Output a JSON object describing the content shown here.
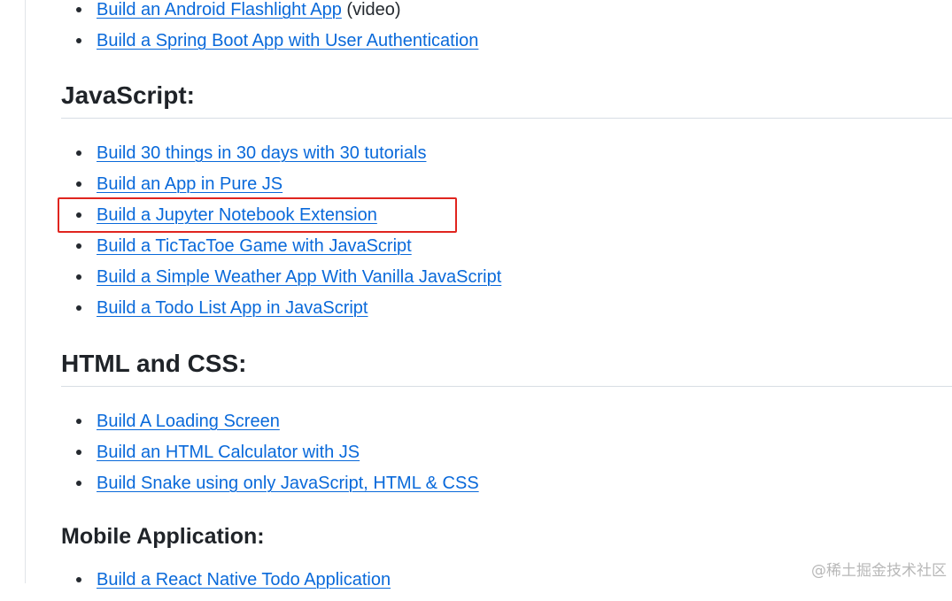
{
  "top_list": [
    {
      "label": "Build an Android Flashlight App",
      "suffix": " (video)"
    },
    {
      "label": "Build a Spring Boot App with User Authentication",
      "suffix": ""
    }
  ],
  "sections": {
    "javascript": {
      "heading": "JavaScript:",
      "items": [
        {
          "label": "Build 30 things in 30 days with 30 tutorials"
        },
        {
          "label": "Build an App in Pure JS"
        },
        {
          "label": "Build a Jupyter Notebook Extension"
        },
        {
          "label": "Build a TicTacToe Game with JavaScript"
        },
        {
          "label": "Build a Simple Weather App With Vanilla JavaScript"
        },
        {
          "label": "Build a Todo List App in JavaScript"
        }
      ]
    },
    "html_css": {
      "heading": "HTML and CSS:",
      "items": [
        {
          "label": "Build A Loading Screen"
        },
        {
          "label": "Build an HTML Calculator with JS"
        },
        {
          "label": "Build Snake using only JavaScript, HTML & CSS"
        }
      ]
    },
    "mobile": {
      "heading": "Mobile Application:",
      "items": [
        {
          "label": "Build a React Native Todo Application"
        }
      ]
    }
  },
  "watermark": "@稀土掘金技术社区",
  "colors": {
    "link": "#0969da",
    "highlight_border": "#e0251f",
    "text": "#24292f"
  }
}
